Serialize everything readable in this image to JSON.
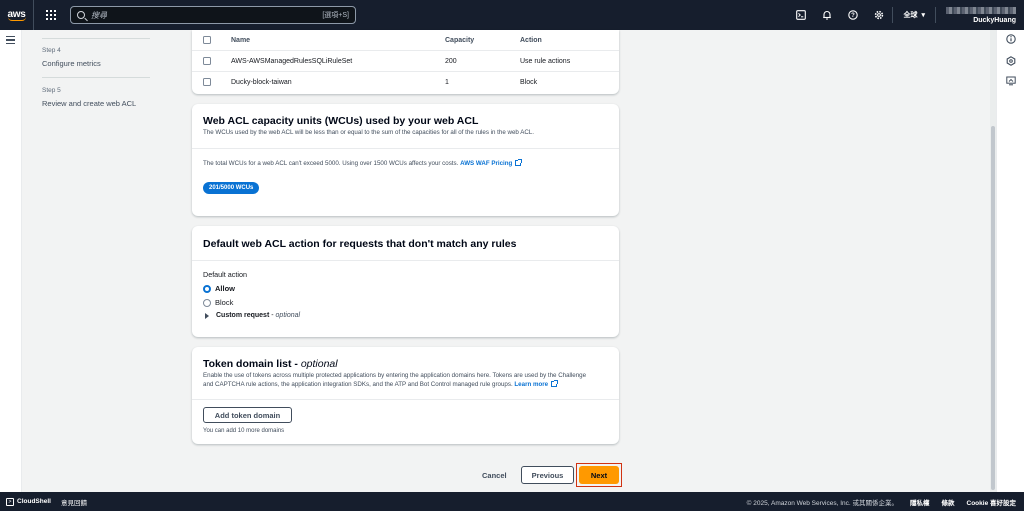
{
  "topnav": {
    "logo": "aws",
    "search_placeholder": "搜尋",
    "search_shortcut": "[選項+S]",
    "region": "全球",
    "user": "DuckyHuang"
  },
  "steps": [
    {
      "label": "Step 4",
      "title": "Configure metrics"
    },
    {
      "label": "Step 5",
      "title": "Review and create web ACL"
    }
  ],
  "rules_table": {
    "headers": {
      "name": "Name",
      "capacity": "Capacity",
      "action": "Action"
    },
    "rows": [
      {
        "name": "AWS-AWSManagedRulesSQLiRuleSet",
        "capacity": "200",
        "action": "Use rule actions"
      },
      {
        "name": "Ducky-block-taiwan",
        "capacity": "1",
        "action": "Block"
      }
    ]
  },
  "wcu": {
    "title": "Web ACL capacity units (WCUs) used by your web ACL",
    "description": "The WCUs used by the web ACL will be less than or equal to the sum of the capacities for all of the rules in the web ACL.",
    "note": "The total WCUs for a web ACL can't exceed 5000. Using over 1500 WCUs affects your costs.",
    "pricing_link": "AWS WAF Pricing",
    "badge": "201/5000 WCUs"
  },
  "default_action": {
    "title": "Default web ACL action for requests that don't match any rules",
    "label": "Default action",
    "options": [
      "Allow",
      "Block"
    ],
    "selected": "Allow",
    "custom_request": "Custom request",
    "custom_request_optional": "optional"
  },
  "token_domain": {
    "title": "Token domain list",
    "optional": "optional",
    "description_1": "Enable the use of tokens across multiple protected applications by entering the application domains here. Tokens are used by the Challenge",
    "description_2": "and CAPTCHA rule actions, the application integration SDKs, and the ATP and Bot Control managed rule groups.",
    "learn_more": "Learn more",
    "add_button": "Add token domain",
    "hint": "You can add 10 more domains"
  },
  "actions": {
    "cancel": "Cancel",
    "previous": "Previous",
    "next": "Next"
  },
  "bottombar": {
    "cloudshell": "CloudShell",
    "feedback": "意見回饋",
    "copyright": "© 2025, Amazon Web Services, Inc. 或其關係企業。",
    "privacy": "隱私權",
    "terms": "條款",
    "cookie": "Cookie 喜好設定"
  },
  "colors": {
    "nav_bg": "#161e2d",
    "primary": "#ff9900",
    "link": "#0972d3",
    "highlight": "#d13212"
  }
}
